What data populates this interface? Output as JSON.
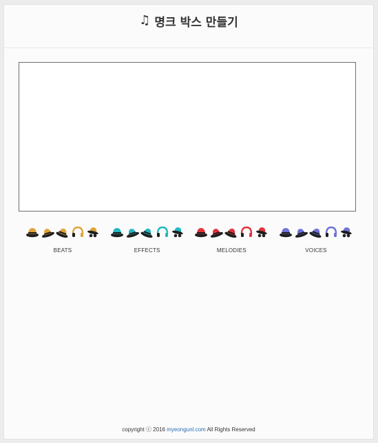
{
  "header": {
    "title": "명크 박스 만들기",
    "icon": "music-note-icon"
  },
  "groups": [
    {
      "label": "BEATS",
      "color": "#e0a33a",
      "count": 5
    },
    {
      "label": "EFFECTS",
      "color": "#21b8c0",
      "count": 5
    },
    {
      "label": "MELODIES",
      "color": "#e3333b",
      "count": 5
    },
    {
      "label": "VOICES",
      "color": "#6f72d8",
      "count": 5
    }
  ],
  "footer": {
    "prefix": "copyright ⓒ 2016",
    "link": "myeongunl.com",
    "suffix": "All Rights Reserved"
  }
}
